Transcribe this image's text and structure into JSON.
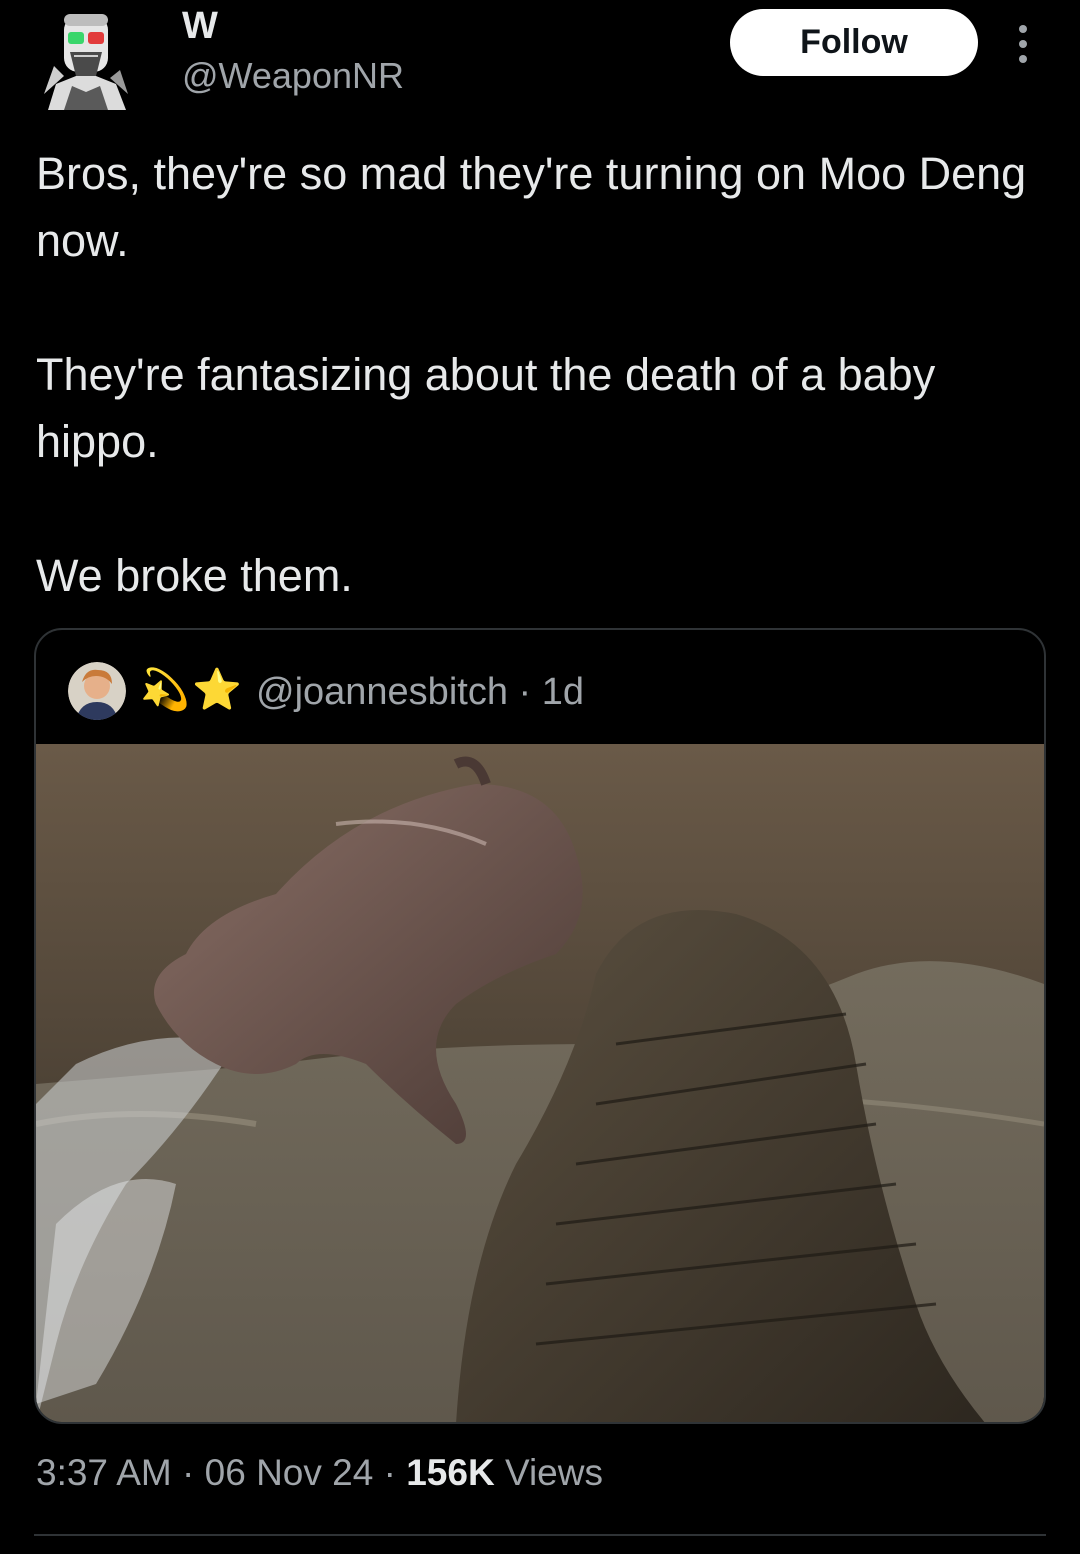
{
  "author": {
    "display_name": "W",
    "handle": "@WeaponNR",
    "avatar_icon": "robot-face-avatar"
  },
  "follow_button": {
    "label": "Follow"
  },
  "more_menu": {
    "icon": "vertical-ellipsis-icon"
  },
  "tweet": {
    "paragraphs": [
      "Bros, they're so mad they're turning on Moo Deng now.",
      "They're fantasizing about the death of a baby hippo.",
      "We broke them."
    ]
  },
  "quoted_tweet": {
    "avatar_icon": "person-photo-avatar",
    "emoji_1": "💫",
    "emoji_2": "⭐",
    "handle": "@joannesbitch",
    "separator": " · ",
    "age": "1d",
    "image_description_icon": "crocodile-attacking-baby-hippo-photo"
  },
  "meta": {
    "time": "3:37 AM",
    "sep1": " · ",
    "date": "06 Nov 24",
    "sep2": " · ",
    "views_count": "156K",
    "views_label": " Views"
  },
  "colors": {
    "background": "#000000",
    "text_primary": "#e7e9ea",
    "text_secondary": "#a0a5aa",
    "border": "#2f3336",
    "button_bg": "#ffffff",
    "button_text": "#0f1419"
  }
}
